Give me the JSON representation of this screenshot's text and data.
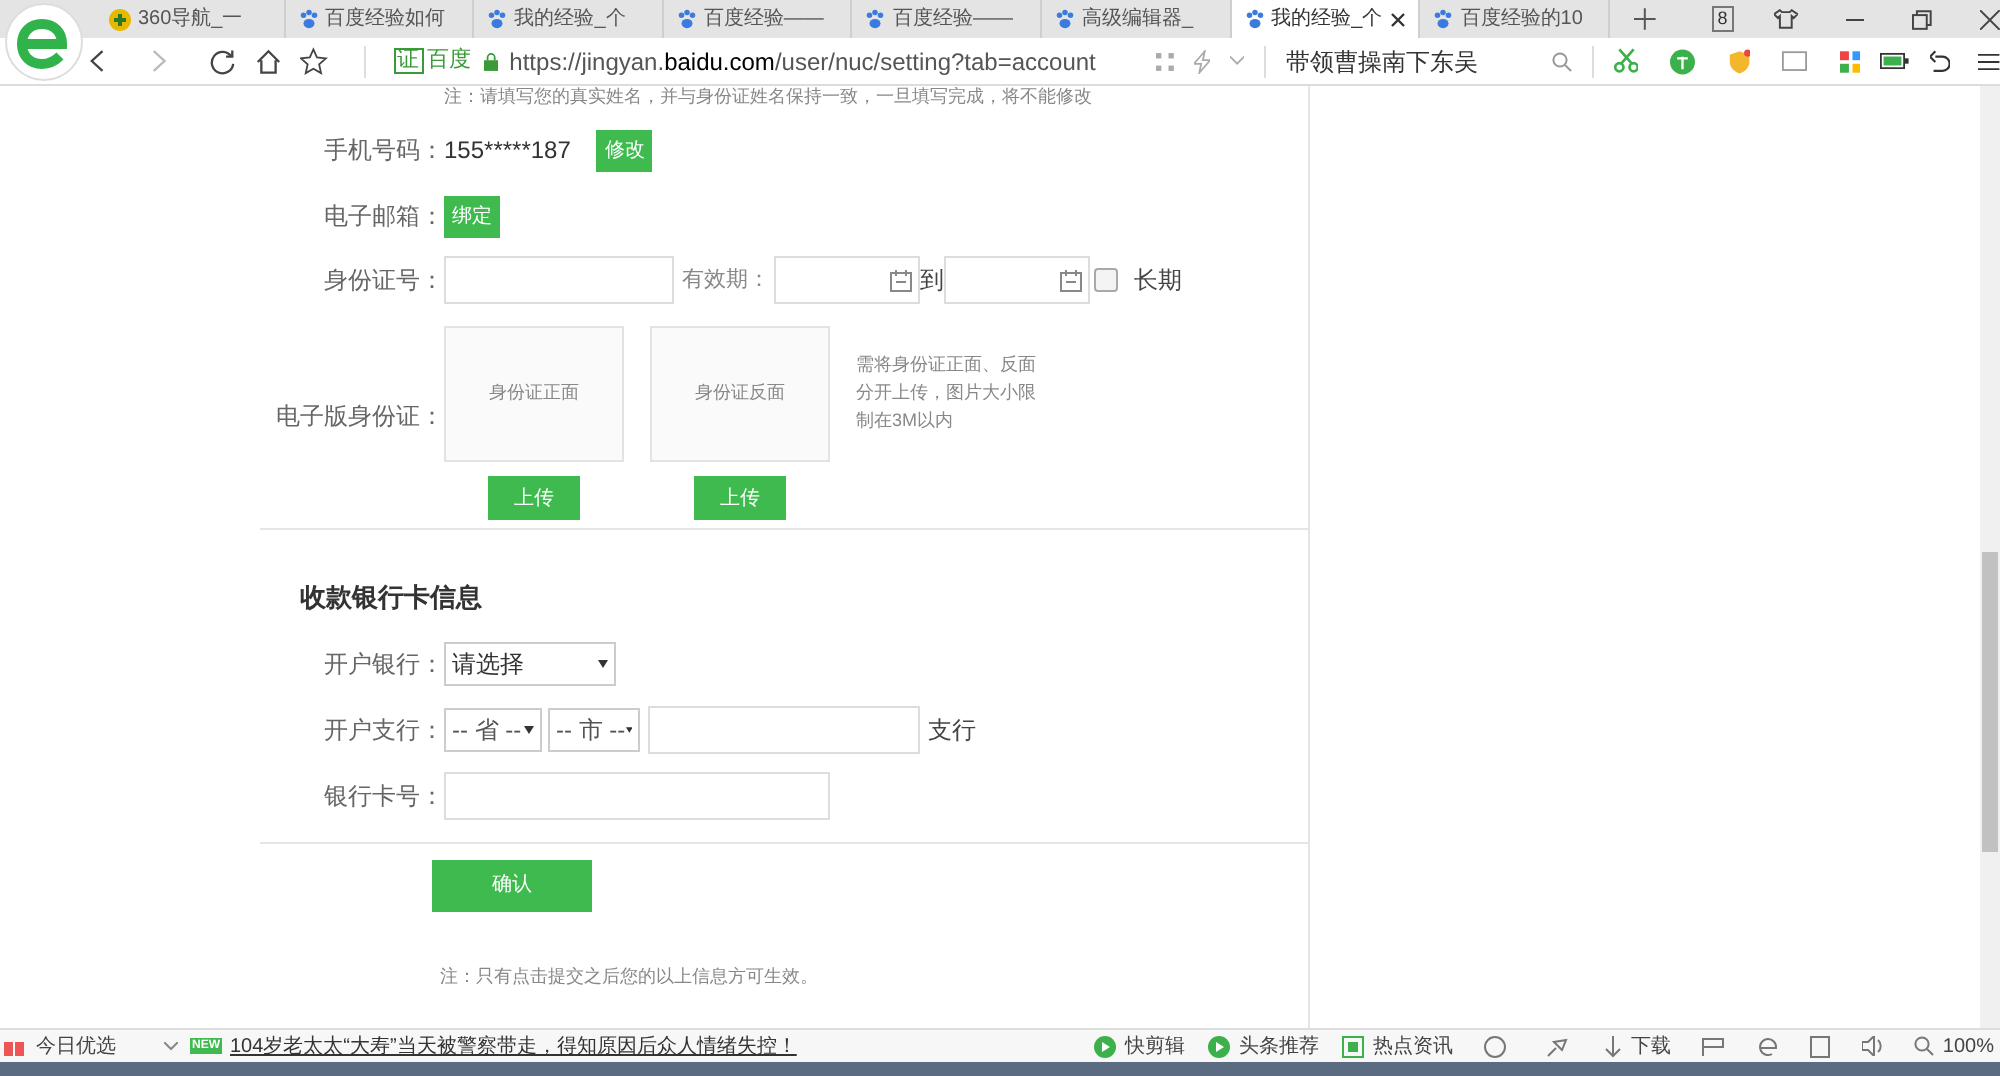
{
  "browser": {
    "tabs": [
      {
        "label": "360导航_一",
        "kind": "nav",
        "selected": false
      },
      {
        "label": "百度经验如何",
        "kind": "paw",
        "selected": false
      },
      {
        "label": "我的经验_个",
        "kind": "paw",
        "selected": false
      },
      {
        "label": "百度经验——",
        "kind": "paw",
        "selected": false
      },
      {
        "label": "百度经验——",
        "kind": "paw",
        "selected": false
      },
      {
        "label": "高级编辑器_",
        "kind": "paw",
        "selected": false
      },
      {
        "label": "我的经验_个",
        "kind": "paw",
        "selected": true
      },
      {
        "label": "百度经验的10",
        "kind": "paw",
        "selected": false
      }
    ],
    "tab_count": "8",
    "address": {
      "verified_badge": "证",
      "badge": "百度",
      "url_prefix": "https://jingyan.",
      "url_domain": "baidu.com",
      "url_rest": "/user/nuc/setting?tab=account"
    },
    "search": {
      "value": "带领曹操南下东吴"
    }
  },
  "form": {
    "top_note": "注：请填写您的真实姓名，并与身份证姓名保持一致，一旦填写完成，将不能修改",
    "phone": {
      "label": "手机号码：",
      "value": "155*****187",
      "button": "修改"
    },
    "email": {
      "label": "电子邮箱：",
      "button": "绑定"
    },
    "id_number": {
      "label": "身份证号：",
      "validity_label": "有效期：",
      "to": "到",
      "long_term": {
        "label": "长期",
        "checked": false
      }
    },
    "id_card": {
      "label": "电子版身份证：",
      "front": "身份证正面",
      "back": "身份证反面",
      "upload_buttons": [
        "上传",
        "上传"
      ],
      "hint": "需将身份证正面、反面分开上传，图片大小限制在3M以内"
    },
    "bank_heading": "收款银行卡信息",
    "bank": {
      "label": "开户银行：",
      "value": "请选择"
    },
    "branch": {
      "label": "开户支行：",
      "province": "-- 省 --",
      "city": "-- 市 --",
      "suffix": "支行"
    },
    "card_number": {
      "label": "银行卡号："
    },
    "confirm": "确认",
    "bottom_note": "注：只有点击提交之后您的以上信息方可生效。"
  },
  "status_bar": {
    "left": "今日优选",
    "news_badge": "NEW",
    "news": "104岁老太太“大寿”当天被警察带走，得知原因后众人情绪失控！",
    "items": [
      "快剪辑",
      "头条推荐",
      "热点资讯"
    ],
    "download": "下载",
    "zoom": "100%"
  }
}
